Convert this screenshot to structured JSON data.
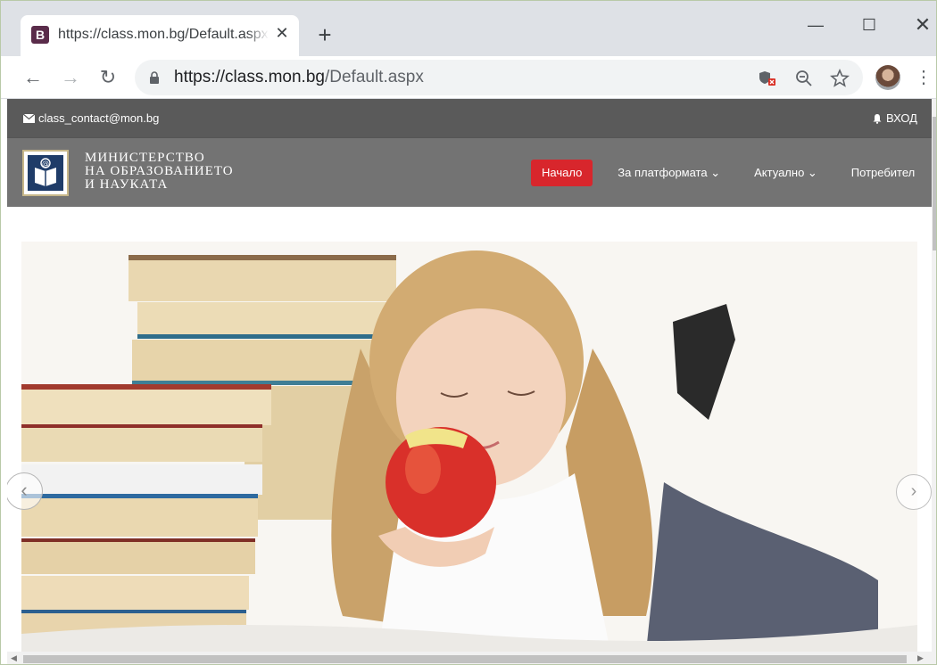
{
  "browser": {
    "tab_title": "https://class.mon.bg/Default.aspx",
    "tab_favicon_letter": "B",
    "tab_close": "✕",
    "new_tab": "+",
    "url_host": "https://class.mon.bg",
    "url_path": "/Default.aspx",
    "window_controls": {
      "minimize": "—",
      "maximize": "☐",
      "close": "✕"
    },
    "nav": {
      "back": "←",
      "forward": "→",
      "reload": "↻"
    },
    "icons": {
      "shield": "shield-blocked-icon",
      "zoom": "zoom-out-icon",
      "star": "star-icon",
      "menu": "⋮"
    }
  },
  "site": {
    "contact_email": "class_contact@mon.bg",
    "login_label": "ВХОД",
    "org_name_lines": [
      "МИНИСТЕРСТВО",
      "НА ОБРАЗОВАНИЕТО",
      "И НАУКАТА"
    ],
    "menu": [
      {
        "label": "Начало",
        "active": true
      },
      {
        "label": "За платформата ⌄",
        "active": false
      },
      {
        "label": "Актуално ⌄",
        "active": false
      },
      {
        "label": "Потребител",
        "active": false
      }
    ],
    "carousel": {
      "prev": "‹",
      "next": "›"
    },
    "colors": {
      "topbar": "#5a5a5a",
      "header": "#737373",
      "active_menu": "#d8262c",
      "logo_blue": "#1f3c68"
    }
  }
}
